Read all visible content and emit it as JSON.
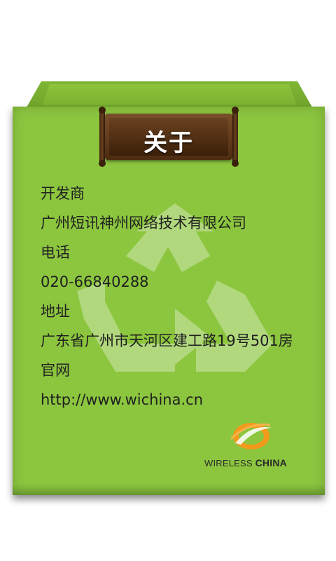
{
  "title": "关于",
  "fields": [
    {
      "label": "开发商",
      "value": "广州短讯神州网络技术有限公司"
    },
    {
      "label": "电话",
      "value": "020-66840288"
    },
    {
      "label": "地址",
      "value": "广东省广州市天河区建工路19号501房"
    },
    {
      "label": "官网",
      "value": "http://www.wichina.cn"
    }
  ],
  "logo": {
    "text_light": "WIRELESS ",
    "text_bold": "CHINA"
  },
  "colors": {
    "box_green": "#8cc63f",
    "banner_brown": "#5a3418",
    "logo_orange": "#f39a1c"
  },
  "icons": [
    "recycle-watermark-icon",
    "wireless-china-logo-icon"
  ]
}
